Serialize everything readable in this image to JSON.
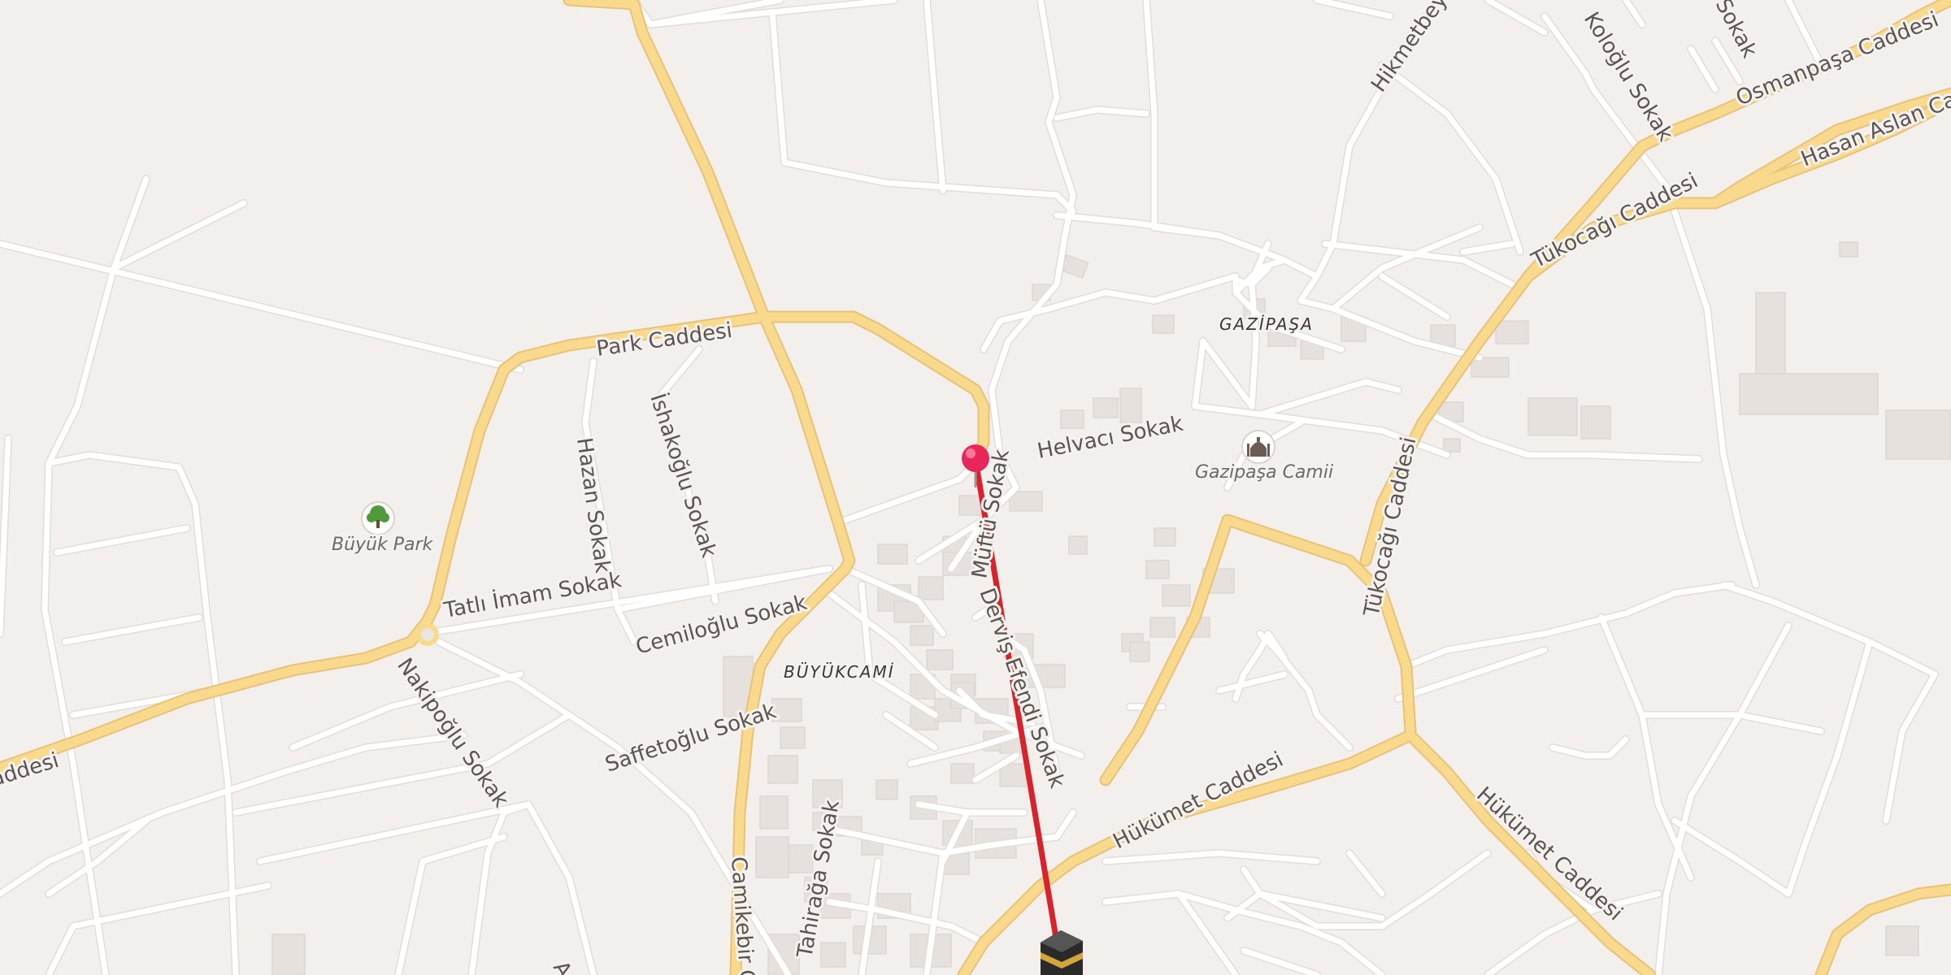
{
  "map": {
    "districts": [
      {
        "id": "gazipasa",
        "name": "GAZİPAŞA"
      },
      {
        "id": "buyukcami",
        "name": "BÜYÜKCAMİ"
      }
    ],
    "pois": [
      {
        "id": "buyuk-park",
        "name": "Büyük Park",
        "icon": "tree-icon",
        "color": "#4f9b3c"
      },
      {
        "id": "gazipasa-camii",
        "name": "Gazipaşa Camii",
        "icon": "mosque-icon",
        "color": "#6b5b53"
      }
    ],
    "streets": {
      "osmanpasa": "Osmanpaşa Caddesi",
      "hasan_aslan": "Hasan Aslan Cad",
      "tukocagi_1": "Tükocağı Caddesi",
      "tukocagi_2": "Tükocağı Caddesi",
      "hukumet_1": "Hükümet Caddesi",
      "hukumet_2": "Hükümet Caddesi",
      "park": "Park Caddesi",
      "helvaci": "Helvacı Sokak",
      "hikmetbey": "Hikmetbey Sokak",
      "kologlu": "Koloğlu Sokak",
      "sokak_edge": "Sokak",
      "hazan": "Hazan Sokak",
      "ishakoglu": "İshakoğlu Sokak",
      "tatli_imam": "Tatlı İmam Sokak",
      "cemiloglu": "Cemiloğlu Sokak",
      "nakipoglu": "Nakipoğlu Sokak",
      "saffetoglu": "Saffetoğlu Sokak",
      "derviş_efendi": "Derviş Efendi Sokak",
      "mufti": "Müftü Sokak",
      "camikebir": "Camikebir C",
      "tahiraga": "Tahirağa Sokak",
      "caddesi_edge": "addesi",
      "bottom_edge": "Aı"
    },
    "route": {
      "color": "#d8232a"
    },
    "markers": {
      "pin": {
        "icon": "map-pin-icon",
        "color": "#e8265a"
      },
      "destination": {
        "icon": "kaaba-icon",
        "color": "#2a2a2a"
      }
    }
  }
}
